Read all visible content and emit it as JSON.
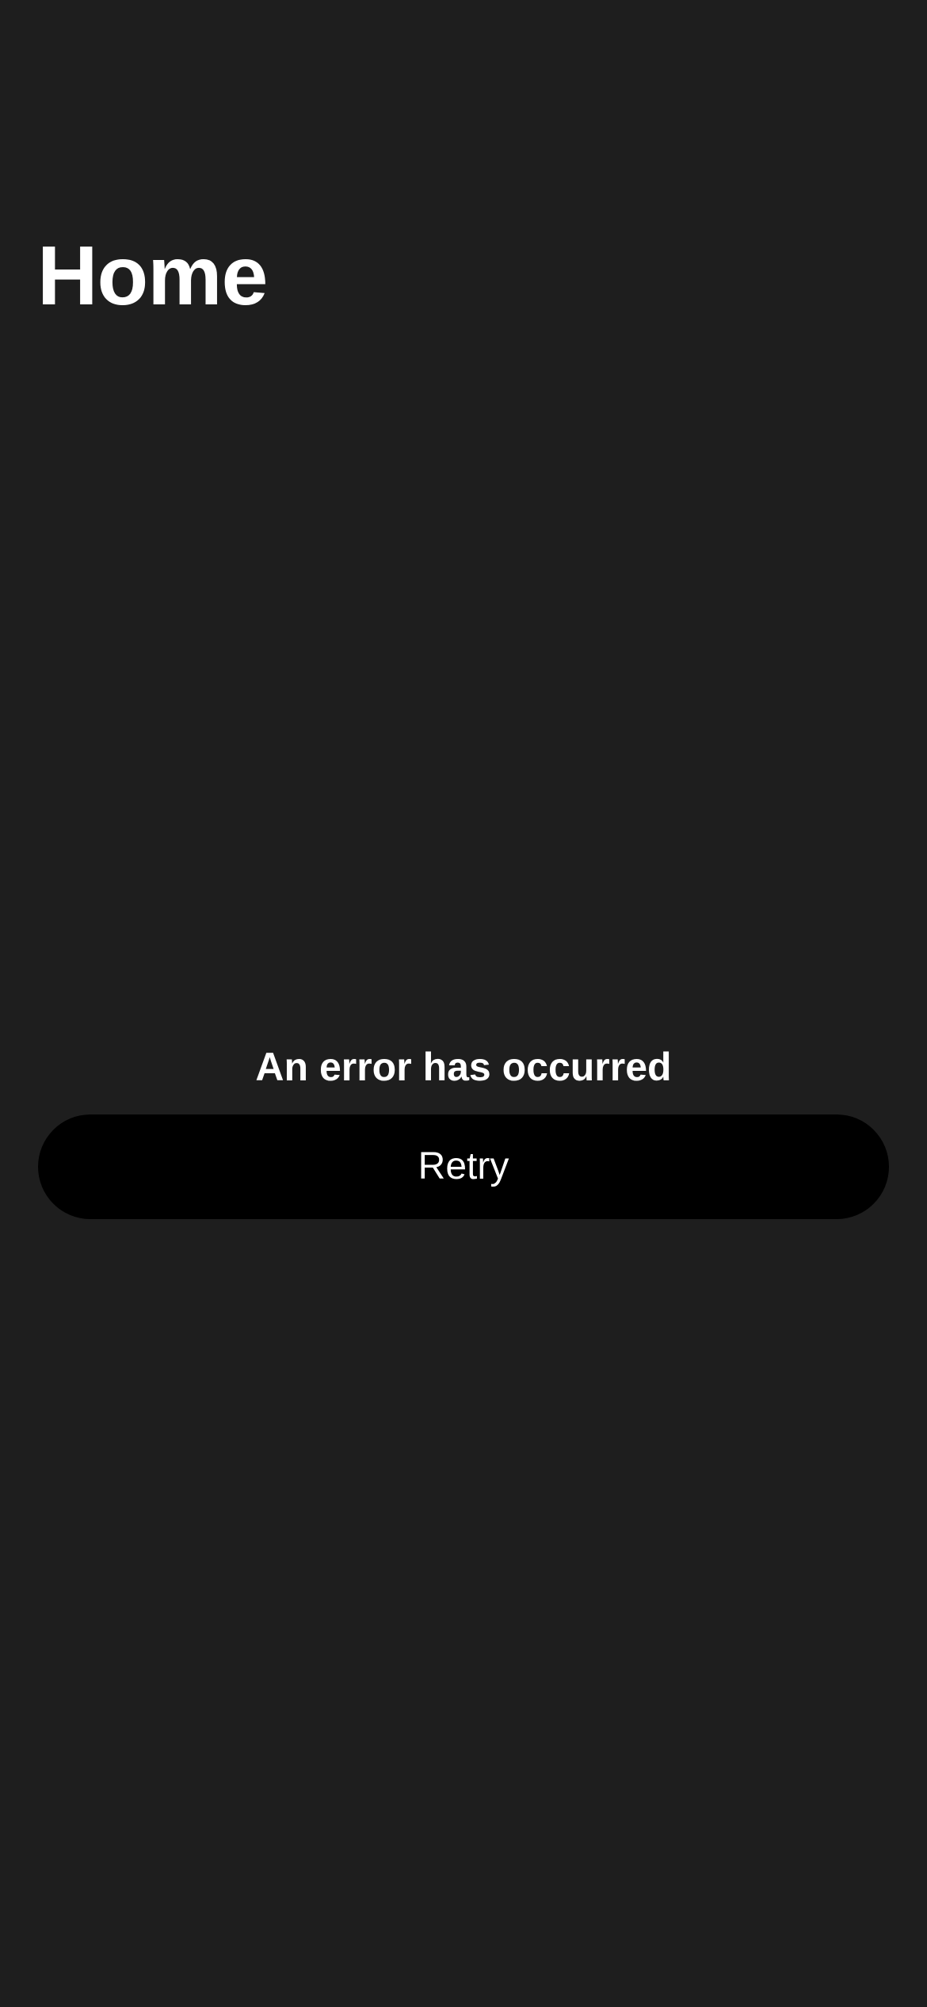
{
  "header": {
    "title": "Home"
  },
  "error": {
    "message": "An error has occurred",
    "retry_label": "Retry"
  },
  "colors": {
    "background": "#1e1e1e",
    "button_background": "#000000",
    "text": "#ffffff"
  }
}
